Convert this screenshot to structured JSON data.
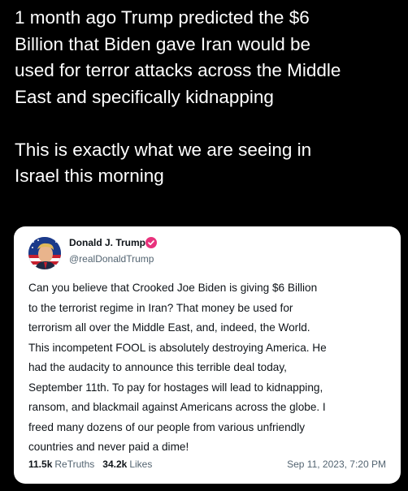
{
  "post": {
    "line1": "1 month ago Trump predicted the $6",
    "line2": "Billion that Biden gave Iran would be",
    "line3": "used for terror attacks across the Middle",
    "line4": "East and specifically kidnapping",
    "line5": "This is exactly what we are seeing in",
    "line6": "Israel this morning"
  },
  "quoted": {
    "author_name": "Donald J. Trump",
    "author_handle": "@realDonaldTrump",
    "avatar_icon": "profile-photo",
    "verified_icon": "verified-badge-icon",
    "verified_color": "#e8327c",
    "body_lines": [
      "Can you believe that Crooked Joe Biden is giving $6 Billion",
      "to the terrorist regime in Iran? That money be used for",
      "terrorism all over the Middle East, and, indeed, the World.",
      "This incompetent FOOL is absolutely destroying America. He",
      "had the audacity to announce this terrible deal today,",
      "September 11th. To pay for hostages will lead to kidnapping,",
      "ransom, and blackmail against Americans across the globe. I",
      "freed many dozens of our people from various unfriendly",
      "countries and never paid a dime!"
    ],
    "retruths_count": "11.5k",
    "retruths_label": "ReTruths",
    "likes_count": "34.2k",
    "likes_label": "Likes",
    "timestamp": "Sep 11, 2023, 7:20 PM"
  }
}
